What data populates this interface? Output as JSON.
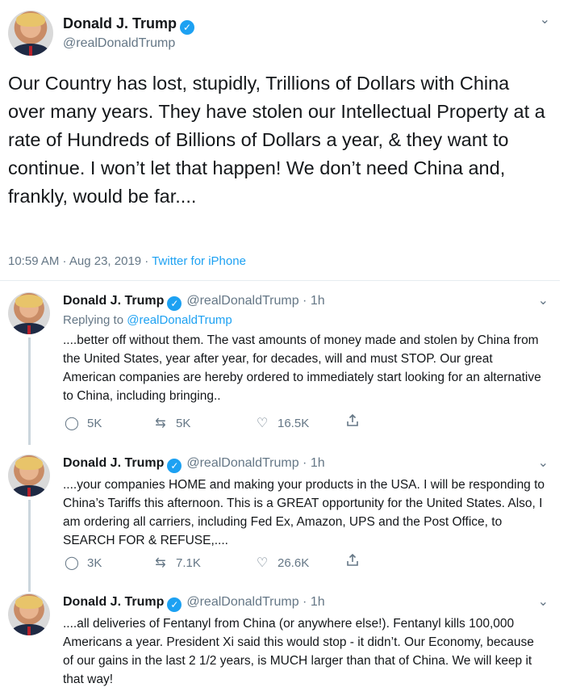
{
  "main": {
    "name": "Donald J. Trump",
    "handle": "@realDonaldTrump",
    "text": "Our Country has lost, stupidly, Trillions of Dollars with China over many years. They have stolen our Intellectual Property at a rate of Hundreds of Billions of Dollars a year, & they want to continue. I won’t let that happen! We don’t need China and, frankly, would be far....",
    "timestamp": "10:59 AM · Aug 23, 2019 · ",
    "source": "Twitter for iPhone"
  },
  "replies": [
    {
      "name": "Donald J. Trump",
      "handle": "@realDonaldTrump · 1h",
      "replying_prefix": "Replying to ",
      "replying_to": "@realDonaldTrump",
      "text": "....better off without them. The vast amounts of money made and stolen by China from the United States, year after year, for decades, will and must STOP. Our great American companies are hereby ordered to immediately start looking for an alternative to China, including bringing..",
      "replies_count": "5K",
      "retweets_count": "5K",
      "likes_count": "16.5K"
    },
    {
      "name": "Donald J. Trump",
      "handle": "@realDonaldTrump · 1h",
      "text": "....your companies HOME and making your products in the USA. I will be responding to China’s Tariffs this afternoon. This is a GREAT opportunity for the United States. Also, I am ordering all carriers, including Fed Ex, Amazon, UPS and the Post Office, to SEARCH FOR & REFUSE,....",
      "replies_count": "3K",
      "retweets_count": "7.1K",
      "likes_count": "26.6K"
    },
    {
      "name": "Donald J. Trump",
      "handle": "@realDonaldTrump · 1h",
      "text": "....all deliveries of Fentanyl from China (or anywhere else!). Fentanyl kills 100,000 Americans a year. President Xi said this would stop - it didn’t. Our Economy, because of our gains in the last 2 1/2 years, is MUCH larger than that of China. We will keep it that way!"
    }
  ],
  "icons": {
    "verified": "verified-badge-icon",
    "caret": "chevron-down-icon",
    "reply": "reply-icon",
    "retweet": "retweet-icon",
    "like": "heart-icon",
    "share": "share-icon"
  },
  "colors": {
    "link": "#1da1f2",
    "muted": "#657786",
    "text": "#14171a"
  }
}
